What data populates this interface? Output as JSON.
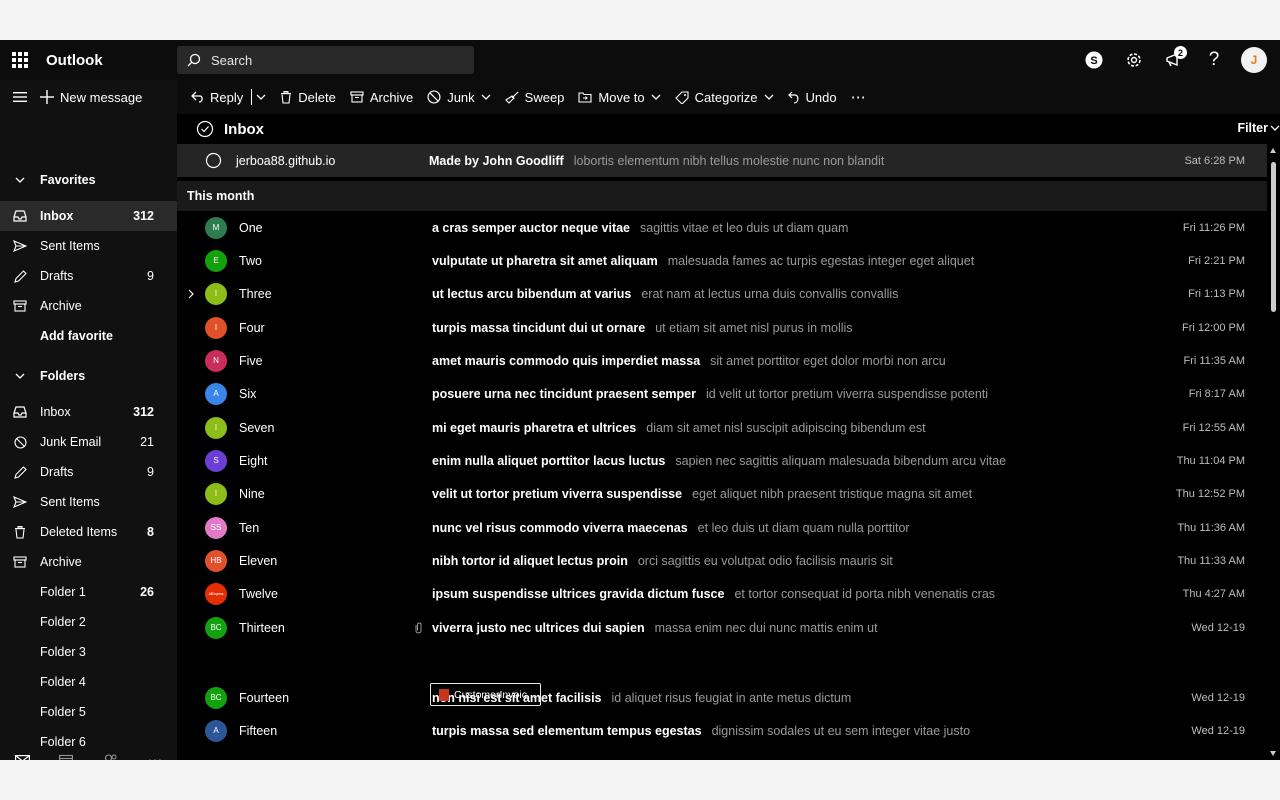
{
  "app": {
    "title": "Outlook"
  },
  "search": {
    "placeholder": "Search"
  },
  "topbar": {
    "notification_count": "2",
    "avatar_letter": "J"
  },
  "nav": {
    "new_message": "New message",
    "favorites_header": "Favorites",
    "favorites": [
      {
        "label": "Inbox",
        "count": "312"
      },
      {
        "label": "Sent Items",
        "count": ""
      },
      {
        "label": "Drafts",
        "count": "9"
      },
      {
        "label": "Archive",
        "count": ""
      },
      {
        "label": "Add favorite",
        "count": ""
      }
    ],
    "folders_header": "Folders",
    "folders": [
      {
        "label": "Inbox",
        "count": "312"
      },
      {
        "label": "Junk Email",
        "count": "21"
      },
      {
        "label": "Drafts",
        "count": "9"
      },
      {
        "label": "Sent Items",
        "count": ""
      },
      {
        "label": "Deleted Items",
        "count": "8"
      },
      {
        "label": "Archive",
        "count": ""
      },
      {
        "label": "Folder 1",
        "count": "26"
      },
      {
        "label": "Folder 2",
        "count": ""
      },
      {
        "label": "Folder 3",
        "count": ""
      },
      {
        "label": "Folder 4",
        "count": ""
      },
      {
        "label": "Folder 5",
        "count": ""
      },
      {
        "label": "Folder 6",
        "count": ""
      }
    ]
  },
  "toolbar": {
    "reply": "Reply",
    "delete": "Delete",
    "archive": "Archive",
    "junk": "Junk",
    "sweep": "Sweep",
    "move_to": "Move to",
    "categorize": "Categorize",
    "undo": "Undo",
    "more": "⋯"
  },
  "list": {
    "title": "Inbox",
    "filter": "Filter",
    "section": "This month",
    "pinned": {
      "from": "jerboa88.github.io",
      "subject": "Made by John Goodliff",
      "preview": "lobortis elementum nibh tellus molestie nunc non blandit",
      "date": "Sat 6:28 PM"
    },
    "attachment_name": "CustomerInvoic...",
    "messages": [
      {
        "initials": "M",
        "color": "#2e7d4f",
        "from": "One",
        "subject": "a cras semper auctor neque vitae",
        "preview": "sagittis vitae et leo duis ut diam quam",
        "date": "Fri 11:26 PM"
      },
      {
        "initials": "E",
        "color": "#13a10e",
        "from": "Two",
        "subject": "vulputate ut pharetra sit amet aliquam",
        "preview": "malesuada fames ac turpis egestas integer eget aliquet",
        "date": "Fri 2:21 PM"
      },
      {
        "initials": "I",
        "color": "#8cbd18",
        "from": "Three",
        "subject": "ut lectus arcu bibendum at varius",
        "preview": "erat nam at lectus urna duis convallis convallis",
        "date": "Fri 1:13 PM"
      },
      {
        "initials": "I",
        "color": "#e0502a",
        "from": "Four",
        "subject": "turpis massa tincidunt dui ut ornare",
        "preview": "ut etiam sit amet nisl purus in mollis",
        "date": "Fri 12:00 PM"
      },
      {
        "initials": "N",
        "color": "#c82e59",
        "from": "Five",
        "subject": "amet mauris commodo quis imperdiet massa",
        "preview": "sit amet porttitor eget dolor morbi non arcu",
        "date": "Fri 11:35 AM"
      },
      {
        "initials": "A",
        "color": "#3a86e8",
        "from": "Six",
        "subject": "posuere urna nec tincidunt praesent semper",
        "preview": "id velit ut tortor pretium viverra suspendisse potenti",
        "date": "Fri 8:17 AM"
      },
      {
        "initials": "I",
        "color": "#8cbd18",
        "from": "Seven",
        "subject": "mi eget mauris pharetra et ultrices",
        "preview": "diam sit amet nisl suscipit adipiscing bibendum est",
        "date": "Fri 12:55 AM"
      },
      {
        "initials": "S",
        "color": "#6b3fd4",
        "from": "Eight",
        "subject": "enim nulla aliquet porttitor lacus luctus",
        "preview": "sapien nec sagittis aliquam malesuada bibendum arcu vitae",
        "date": "Thu 11:04 PM"
      },
      {
        "initials": "I",
        "color": "#8cbd18",
        "from": "Nine",
        "subject": "velit ut tortor pretium viverra suspendisse",
        "preview": "eget aliquet nibh praesent tristique magna sit amet",
        "date": "Thu 12:52 PM"
      },
      {
        "initials": "SS",
        "color": "#e37ac8",
        "from": "Ten",
        "subject": "nunc vel risus commodo viverra maecenas",
        "preview": "et leo duis ut diam quam nulla porttitor",
        "date": "Thu 11:36 AM"
      },
      {
        "initials": "HB",
        "color": "#e0502a",
        "from": "Eleven",
        "subject": "nibh tortor id aliquet lectus proin",
        "preview": "orci sagittis eu volutpat odio facilisis mauris sit",
        "date": "Thu 11:33 AM"
      },
      {
        "initials": "AliExpress",
        "color": "#e62e04",
        "from": "Twelve",
        "subject": "ipsum suspendisse ultrices gravida dictum fusce",
        "preview": "et tortor consequat id porta nibh venenatis cras",
        "date": "Thu 4:27 AM"
      },
      {
        "initials": "BC",
        "color": "#13a10e",
        "from": "Thirteen",
        "subject": "viverra justo nec ultrices dui sapien",
        "preview": "massa enim nec dui nunc mattis enim ut",
        "date": "Wed 12-19"
      },
      {
        "initials": "BC",
        "color": "#13a10e",
        "from": "Fourteen",
        "subject": "non nisi est sit amet facilisis",
        "preview": "id aliquet risus feugiat in ante metus dictum",
        "date": "Wed 12-19"
      },
      {
        "initials": "A",
        "color": "#2b579a",
        "from": "Fifteen",
        "subject": "turpis massa sed elementum tempus egestas",
        "preview": "dignissim sodales ut eu sem integer vitae justo",
        "date": "Wed 12-19"
      }
    ]
  }
}
